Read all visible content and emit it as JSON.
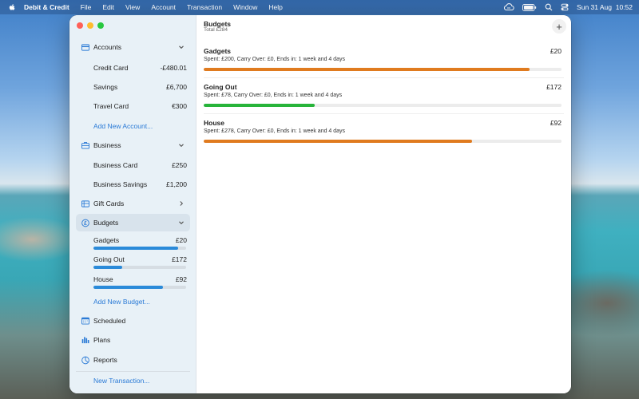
{
  "menubar": {
    "app_name": "Debit & Credit",
    "items": [
      "File",
      "Edit",
      "View",
      "Account",
      "Transaction",
      "Window",
      "Help"
    ],
    "clock": "Sun 31 Aug  10:52"
  },
  "sidebar": {
    "accounts": {
      "label": "Accounts",
      "items": [
        {
          "label": "Credit Card",
          "value": "-£480.01"
        },
        {
          "label": "Savings",
          "value": "£6,700"
        },
        {
          "label": "Travel Card",
          "value": "€300"
        }
      ],
      "add_link": "Add New Account..."
    },
    "business": {
      "label": "Business",
      "items": [
        {
          "label": "Business Card",
          "value": "£250"
        },
        {
          "label": "Business Savings",
          "value": "£1,200"
        }
      ]
    },
    "gift_cards": {
      "label": "Gift Cards"
    },
    "budgets": {
      "label": "Budgets",
      "items": [
        {
          "label": "Gadgets",
          "value": "£20",
          "progress": 0.91
        },
        {
          "label": "Going Out",
          "value": "£172",
          "progress": 0.31
        },
        {
          "label": "House",
          "value": "£92",
          "progress": 0.75
        }
      ],
      "add_link": "Add New Budget..."
    },
    "scheduled": {
      "label": "Scheduled"
    },
    "plans": {
      "label": "Plans"
    },
    "reports": {
      "label": "Reports"
    },
    "new_transaction": "New Transaction..."
  },
  "main": {
    "title": "Budgets",
    "subtitle": "Total £284",
    "add_symbol": "+",
    "budgets": [
      {
        "name": "Gadgets",
        "amount": "£20",
        "detail": "Spent: £200, Carry Over: £0, Ends in: 1 week and 4 days",
        "progress": 0.91,
        "color": "#e07b1f"
      },
      {
        "name": "Going Out",
        "amount": "£172",
        "detail": "Spent: £78, Carry Over: £0, Ends in: 1 week and 4 days",
        "progress": 0.31,
        "color": "#27b43a"
      },
      {
        "name": "House",
        "amount": "£92",
        "detail": "Spent: £278, Carry Over: £0, Ends in: 1 week and 4 days",
        "progress": 0.75,
        "color": "#e07b1f"
      }
    ]
  },
  "colors": {
    "accent": "#2a7ad6",
    "sidebar_progress": "#2a8ad9"
  }
}
